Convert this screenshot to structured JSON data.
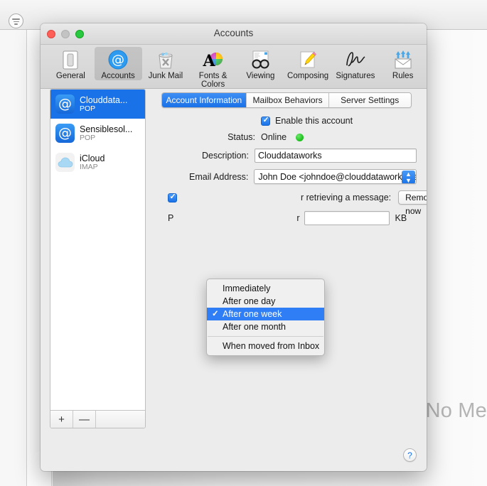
{
  "background_app": {
    "toolbar_icon": "list-lines-icon",
    "empty_state_text": "No Me"
  },
  "window": {
    "title": "Accounts",
    "traffic_lights": {
      "close": "close-button",
      "minimize": "minimize-button",
      "zoom": "zoom-button"
    }
  },
  "toolbar": {
    "items": [
      {
        "label": "General",
        "icon": "general-icon",
        "selected": false
      },
      {
        "label": "Accounts",
        "icon": "accounts-at-icon",
        "selected": true
      },
      {
        "label": "Junk Mail",
        "icon": "junk-mail-trash-icon",
        "selected": false
      },
      {
        "label": "Fonts & Colors",
        "icon": "fonts-colors-icon",
        "selected": false
      },
      {
        "label": "Viewing",
        "icon": "viewing-glasses-icon",
        "selected": false
      },
      {
        "label": "Composing",
        "icon": "composing-pencil-icon",
        "selected": false
      },
      {
        "label": "Signatures",
        "icon": "signatures-icon",
        "selected": false
      },
      {
        "label": "Rules",
        "icon": "rules-envelope-icon",
        "selected": false
      }
    ]
  },
  "accounts_list": {
    "items": [
      {
        "name": "Clouddata...",
        "type": "POP",
        "icon": "at-account-icon",
        "selected": true
      },
      {
        "name": "Sensiblesol...",
        "type": "POP",
        "icon": "at-account-icon",
        "selected": false
      },
      {
        "name": "iCloud",
        "type": "IMAP",
        "icon": "icloud-cloud-icon",
        "selected": false
      }
    ],
    "add_button": "+",
    "remove_button": "—"
  },
  "tabs": [
    {
      "label": "Account Information",
      "active": true
    },
    {
      "label": "Mailbox Behaviors",
      "active": false
    },
    {
      "label": "Server Settings",
      "active": false
    }
  ],
  "form": {
    "enable_account_label": "Enable this account",
    "enable_account_checked": true,
    "status_label": "Status:",
    "status_value": "Online",
    "status_color": "#21c421",
    "description_label": "Description:",
    "description_value": "Clouddataworks",
    "email_label": "Email Address:",
    "email_value": "John Doe <johndoe@clouddataworks.ca>",
    "remove_copy_label": "r retrieving a message:",
    "remove_now_button": "Remove now",
    "size_row_label_fragment": "P",
    "size_row_suffix_fragment": "r",
    "size_field_value": "",
    "size_unit": "KB"
  },
  "dropdown": {
    "options": [
      {
        "label": "Immediately",
        "selected": false,
        "separator_before": false
      },
      {
        "label": "After one day",
        "selected": false,
        "separator_before": false
      },
      {
        "label": "After one week",
        "selected": true,
        "separator_before": false
      },
      {
        "label": "After one month",
        "selected": false,
        "separator_before": false
      },
      {
        "label": "When moved from Inbox",
        "selected": false,
        "separator_before": true
      }
    ],
    "checkmark": "✓",
    "highlight_color": "#2f7ef5"
  },
  "help_button": "?"
}
